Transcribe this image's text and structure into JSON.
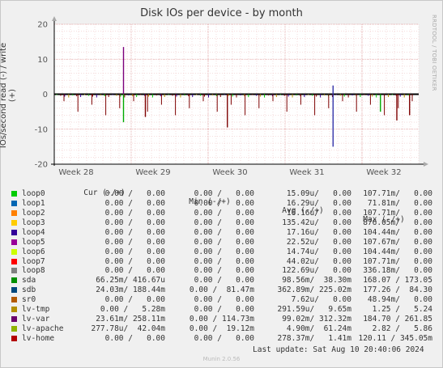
{
  "chart_data": {
    "type": "line",
    "title": "Disk IOs per device - by month",
    "ylabel": "IOs/second read (-) / write (+)",
    "ylim": [
      -20,
      20
    ],
    "yticks": [
      -20,
      -10,
      0,
      10,
      20
    ],
    "xticks": [
      "Week 28",
      "Week 29",
      "Week 30",
      "Week 31",
      "Week 32"
    ],
    "grid": true,
    "spikes": [
      {
        "x": 0.19,
        "v": 13.5,
        "color": "#7b007b"
      },
      {
        "x": 0.19,
        "v": -8,
        "color": "#00aa00"
      },
      {
        "x": 0.25,
        "v": -6.5,
        "color": "#7e0000"
      },
      {
        "x": 0.475,
        "v": -9.5,
        "color": "#7e0000"
      },
      {
        "x": 0.765,
        "v": 2.5,
        "color": "#3333aa"
      },
      {
        "x": 0.765,
        "v": -15,
        "color": "#3333aa"
      },
      {
        "x": 0.895,
        "v": -5,
        "color": "#00aa00"
      },
      {
        "x": 0.94,
        "v": -7.5,
        "color": "#7e0000"
      },
      {
        "x": 0.975,
        "v": -6,
        "color": "#7e0000"
      }
    ]
  },
  "legend": {
    "cols": [
      "Cur (-/+)",
      "Min (-/+)",
      "Avg (-/+)",
      "Max (-/+)"
    ],
    "rows": [
      {
        "name": "loop0",
        "color": "#00cc00",
        "cur": "0.00 /   0.00",
        "min": "0.00 /   0.00",
        "avg": "15.09u/   0.00",
        "max": "107.71m/   0.00"
      },
      {
        "name": "loop1",
        "color": "#0066b3",
        "cur": "0.00 /   0.00",
        "min": "0.00 /   0.00",
        "avg": "16.29u/   0.00",
        "max": "71.81m/   0.00"
      },
      {
        "name": "loop2",
        "color": "#ff8000",
        "cur": "0.00 /   0.00",
        "min": "0.00 /   0.00",
        "avg": "16.16u/   0.00",
        "max": "107.71m/   0.00"
      },
      {
        "name": "loop3",
        "color": "#ffcc00",
        "cur": "0.00 /   0.00",
        "min": "0.00 /   0.00",
        "avg": "135.42u/   0.00",
        "max": "876.05m/   0.00"
      },
      {
        "name": "loop4",
        "color": "#330099",
        "cur": "0.00 /   0.00",
        "min": "0.00 /   0.00",
        "avg": "17.16u/   0.00",
        "max": "104.44m/   0.00"
      },
      {
        "name": "loop5",
        "color": "#990099",
        "cur": "0.00 /   0.00",
        "min": "0.00 /   0.00",
        "avg": "22.52u/   0.00",
        "max": "107.67m/   0.00"
      },
      {
        "name": "loop6",
        "color": "#ccff00",
        "cur": "0.00 /   0.00",
        "min": "0.00 /   0.00",
        "avg": "14.74u/   0.00",
        "max": "104.44m/   0.00"
      },
      {
        "name": "loop7",
        "color": "#ff0000",
        "cur": "0.00 /   0.00",
        "min": "0.00 /   0.00",
        "avg": "44.02u/   0.00",
        "max": "107.71m/   0.00"
      },
      {
        "name": "loop8",
        "color": "#808080",
        "cur": "0.00 /   0.00",
        "min": "0.00 /   0.00",
        "avg": "122.69u/   0.00",
        "max": "336.18m/   0.00"
      },
      {
        "name": "sda",
        "color": "#008f00",
        "cur": "66.25m/ 416.67u",
        "min": "0.00 /   0.00",
        "avg": "98.56m/  38.30m",
        "max": "168.07 / 173.05"
      },
      {
        "name": "sdb",
        "color": "#00487d",
        "cur": "24.03m/ 188.44m",
        "min": "0.00 /  81.47m",
        "avg": "362.89m/ 225.02m",
        "max": "177.26 /  84.30"
      },
      {
        "name": "sr0",
        "color": "#b35a00",
        "cur": "0.00 /   0.00",
        "min": "0.00 /   0.00",
        "avg": "7.62u/   0.00",
        "max": "48.94m/   0.00"
      },
      {
        "name": "lv-tmp",
        "color": "#b38f00",
        "cur": "0.00 /   5.28m",
        "min": "0.00 /   0.00",
        "avg": "291.59u/   9.65m",
        "max": "1.25 /   5.24"
      },
      {
        "name": "lv-var",
        "color": "#6b006b",
        "cur": "23.61m/ 258.11m",
        "min": "0.00 / 114.73m",
        "avg": "99.02m/ 312.32m",
        "max": "184.70 / 261.85"
      },
      {
        "name": "lv-apache",
        "color": "#8fb300",
        "cur": "277.78u/  42.04m",
        "min": "0.00 /  19.12m",
        "avg": "4.90m/  61.24m",
        "max": "2.82 /   5.86"
      },
      {
        "name": "lv-home",
        "color": "#b30000",
        "cur": "0.00 /   0.00",
        "min": "0.00 /   0.00",
        "avg": "278.37m/   1.41m",
        "max": "120.11 / 345.05m"
      }
    ]
  },
  "last_update": "Last update: Sat Aug 10 20:40:06 2024",
  "side_text": "RRDTOOL / TOBI OETIKER",
  "munin": "Munin 2.0.56"
}
